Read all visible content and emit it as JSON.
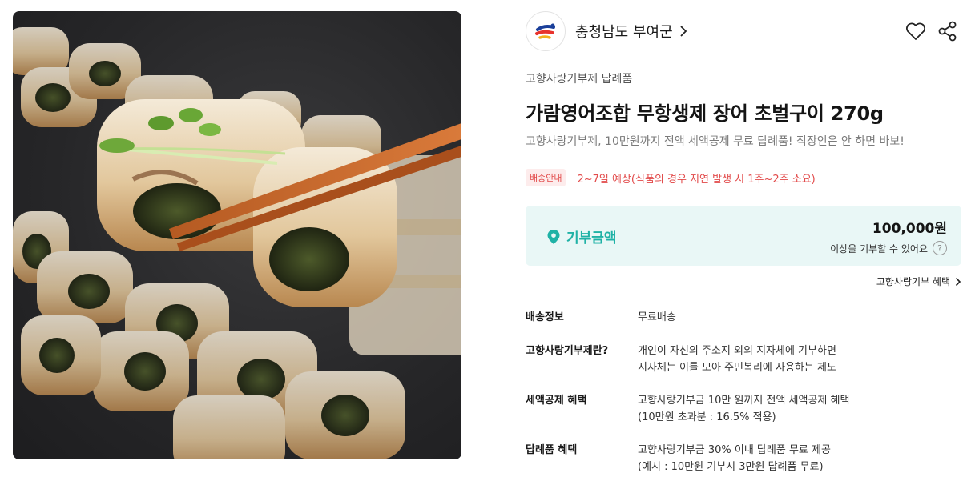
{
  "product_image": {
    "alt": "장어 초벌구이",
    "icon": "product-photo"
  },
  "seller": {
    "name": "충청남도 부여군",
    "logo_icon": "buyeo-county-logo"
  },
  "actions": {
    "like_icon": "heart-icon",
    "share_icon": "share-icon"
  },
  "category": "고향사랑기부제 답례품",
  "title": "가람영어조합 무항생제 장어 초벌구이 270g",
  "subtitle": "고향사랑기부제, 10만원까지 전액 세액공제 무료 답례품! 직장인은 안 하면 바보!",
  "shipping": {
    "badge": "배송안내",
    "text": "2~7일 예상(식품의 경우 지연 발생 시 1주~2주 소요)"
  },
  "donation": {
    "label": "기부금액",
    "amount": "100,000원",
    "note": "이상을 기부할 수 있어요",
    "help": "?"
  },
  "benefit_link": "고향사랑기부 혜택",
  "info": [
    {
      "key": "배송정보",
      "lines": [
        "무료배송"
      ]
    },
    {
      "key": "고향사랑기부제란?",
      "lines": [
        "개인이 자신의 주소지 외의 지자체에 기부하면",
        "지자체는 이를 모아 주민복리에 사용하는 제도"
      ]
    },
    {
      "key": "세액공제 혜택",
      "lines": [
        "고향사랑기부금 10만 원까지 전액 세액공제 혜택",
        "(10만원 초과분 : 16.5% 적용)"
      ]
    },
    {
      "key": "답례품 혜택",
      "lines": [
        "고향사랑기부금 30% 이내 답례품 무료 제공",
        "(예시 : 10만원 기부시 3만원 답례품 무료)"
      ]
    }
  ],
  "colors": {
    "accent_teal": "#1fb2a6",
    "donate_bg": "#e9f7f6",
    "shipping_red": "#e24a4a",
    "badge_bg": "#fdecec"
  }
}
